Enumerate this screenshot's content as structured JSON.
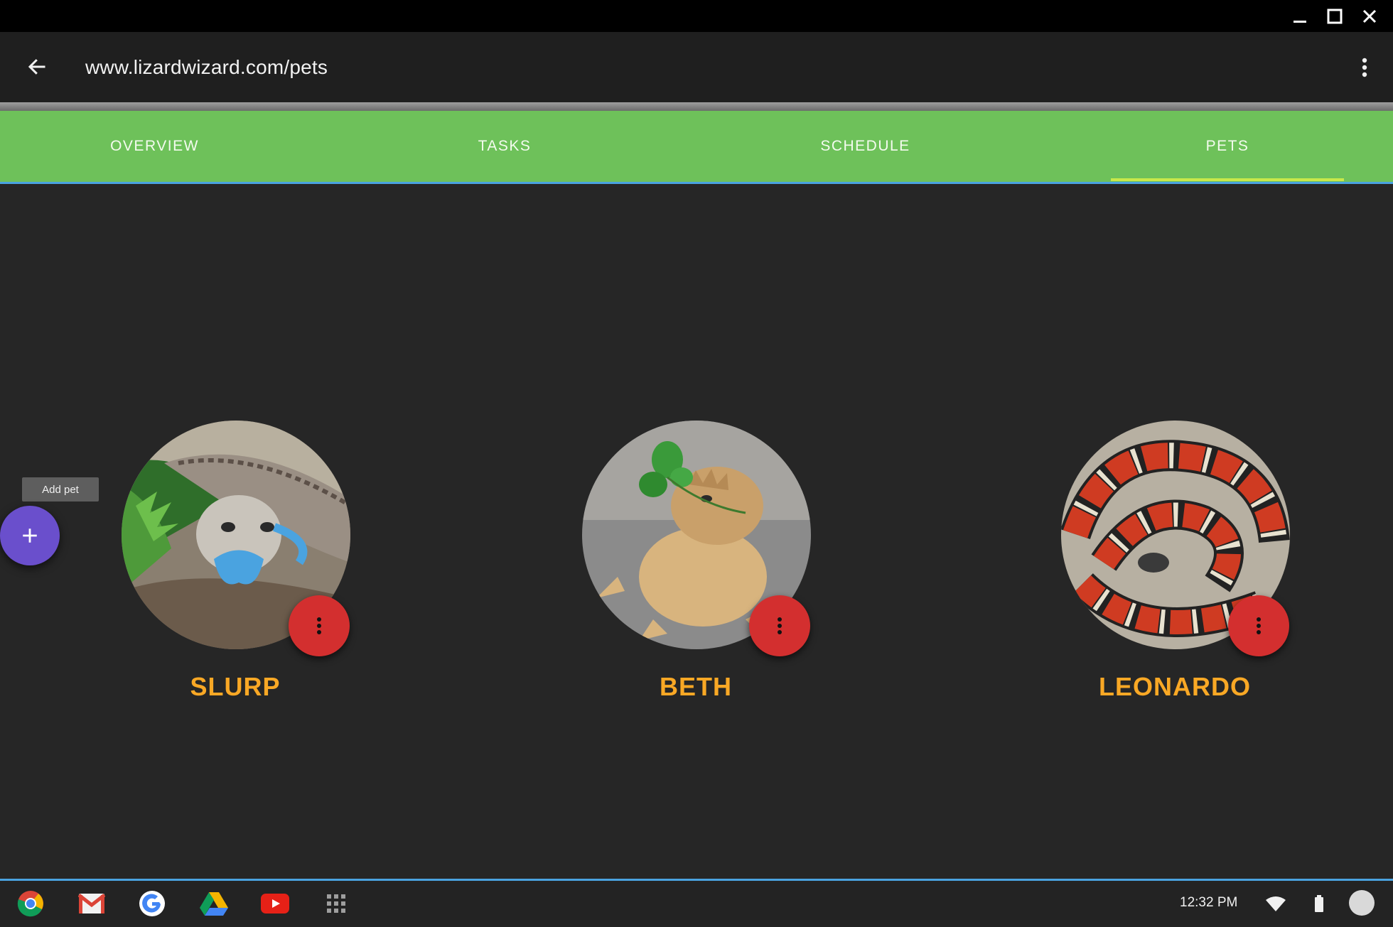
{
  "window": {
    "controls": [
      "minimize-icon",
      "maximize-icon",
      "close-icon"
    ]
  },
  "appbar": {
    "url": "www.lizardwizard.com/pets",
    "back_icon": "arrow-back-icon",
    "menu_icon": "more-vert-icon"
  },
  "tabs": [
    {
      "label": "OVERVIEW"
    },
    {
      "label": "TASKS"
    },
    {
      "label": "SCHEDULE"
    },
    {
      "label": "PETS",
      "selected": true
    }
  ],
  "pets": [
    {
      "name": "SLURP",
      "photo": "blue-tongued skink"
    },
    {
      "name": "BETH",
      "photo": "bearded dragon"
    },
    {
      "name": "LEONARDO",
      "photo": "milk snake"
    }
  ],
  "fab": {
    "tooltip": "Add pet",
    "icon": "plus-icon"
  },
  "shelf": {
    "apps": [
      "chrome-icon",
      "gmail-icon",
      "google-icon",
      "drive-icon",
      "youtube-icon",
      "launcher-icon"
    ],
    "time": "12:32 PM",
    "status": [
      "wifi-icon",
      "battery-icon",
      "avatar"
    ]
  },
  "colors": {
    "tab_bar": "#6ec15a",
    "accent_line": "#4aa3e0",
    "pet_name": "#f9a825",
    "pet_menu": "#d32f2f",
    "fab": "#6a4fcc",
    "background": "#262626"
  }
}
